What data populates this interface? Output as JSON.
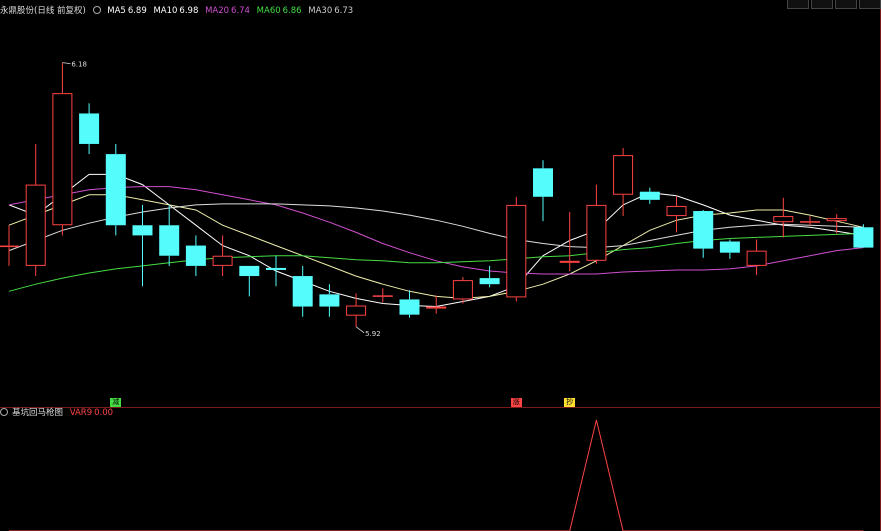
{
  "header": {
    "stock_name": "永鼎股份(日线 前复权)",
    "ma": [
      {
        "label": "MA5",
        "value": "6.89",
        "color": "#ffffff"
      },
      {
        "label": "MA10",
        "value": "6.98",
        "color": "#ffffff"
      },
      {
        "label": "MA20",
        "value": "6.74",
        "color": "#d050d0"
      },
      {
        "label": "MA60",
        "value": "6.86",
        "color": "#44dd44"
      },
      {
        "label": "MA30",
        "value": "6.73",
        "color": "#cccccc"
      }
    ]
  },
  "top_buttons": [
    "",
    "",
    "",
    ""
  ],
  "annotations": {
    "high": "6.18",
    "low": "5.92"
  },
  "indicator": {
    "name": "基坑回马枪图",
    "var_label": "VAR9",
    "var_value": "0.00"
  },
  "signals": [
    {
      "index": 4,
      "text": "减",
      "color": "#44dd44"
    },
    {
      "index": 19,
      "text": "涨",
      "color": "#ff4444"
    },
    {
      "index": 21,
      "text": "抄",
      "color": "#ffdd33"
    }
  ],
  "colors": {
    "up": "#ff4444",
    "down": "#54fcfc",
    "bg": "#000000",
    "border": "#7a1a1a",
    "ma5": "#ffffff",
    "ma10": "#eeeeaa",
    "ma20": "#d050d0",
    "ma30": "#dddddd",
    "ma60": "#44dd44"
  },
  "chart_data": {
    "type": "candlestick",
    "price_range": [
      5.85,
      6.22
    ],
    "candles": [
      {
        "o": 6.0,
        "h": 6.02,
        "l": 5.98,
        "c": 6.0
      },
      {
        "o": 5.98,
        "h": 6.1,
        "l": 5.97,
        "c": 6.06
      },
      {
        "o": 6.02,
        "h": 6.18,
        "l": 6.01,
        "c": 6.15
      },
      {
        "o": 6.13,
        "h": 6.14,
        "l": 6.09,
        "c": 6.1
      },
      {
        "o": 6.09,
        "h": 6.1,
        "l": 6.01,
        "c": 6.02
      },
      {
        "o": 6.02,
        "h": 6.04,
        "l": 5.96,
        "c": 6.01
      },
      {
        "o": 6.02,
        "h": 6.04,
        "l": 5.98,
        "c": 5.99
      },
      {
        "o": 6.0,
        "h": 6.01,
        "l": 5.97,
        "c": 5.98
      },
      {
        "o": 5.98,
        "h": 6.01,
        "l": 5.97,
        "c": 5.99
      },
      {
        "o": 5.98,
        "h": 5.98,
        "l": 5.95,
        "c": 5.97
      },
      {
        "o": 5.978,
        "h": 5.99,
        "l": 5.96,
        "c": 5.976
      },
      {
        "o": 5.97,
        "h": 5.98,
        "l": 5.93,
        "c": 5.94
      },
      {
        "o": 5.952,
        "h": 5.962,
        "l": 5.93,
        "c": 5.94
      },
      {
        "o": 5.931,
        "h": 5.953,
        "l": 5.92,
        "c": 5.941
      },
      {
        "o": 5.95,
        "h": 5.958,
        "l": 5.944,
        "c": 5.951
      },
      {
        "o": 5.947,
        "h": 5.956,
        "l": 5.929,
        "c": 5.932
      },
      {
        "o": 5.938,
        "h": 5.951,
        "l": 5.933,
        "c": 5.94
      },
      {
        "o": 5.947,
        "h": 5.969,
        "l": 5.943,
        "c": 5.966
      },
      {
        "o": 5.968,
        "h": 5.98,
        "l": 5.959,
        "c": 5.962
      },
      {
        "o": 5.949,
        "h": 6.048,
        "l": 5.945,
        "c": 6.04
      },
      {
        "o": 6.076,
        "h": 6.084,
        "l": 6.024,
        "c": 6.048
      },
      {
        "o": 5.983,
        "h": 6.033,
        "l": 5.975,
        "c": 5.985
      },
      {
        "o": 5.985,
        "h": 6.06,
        "l": 5.982,
        "c": 6.04
      },
      {
        "o": 6.05,
        "h": 6.096,
        "l": 6.029,
        "c": 6.089
      },
      {
        "o": 6.053,
        "h": 6.057,
        "l": 6.041,
        "c": 6.045
      },
      {
        "o": 6.029,
        "h": 6.049,
        "l": 6.013,
        "c": 6.039
      },
      {
        "o": 6.034,
        "h": 6.035,
        "l": 5.988,
        "c": 5.997
      },
      {
        "o": 6.004,
        "h": 6.006,
        "l": 5.987,
        "c": 5.993
      },
      {
        "o": 5.98,
        "h": 6.006,
        "l": 5.971,
        "c": 5.995
      },
      {
        "o": 6.023,
        "h": 6.047,
        "l": 6.008,
        "c": 6.029
      },
      {
        "o": 6.023,
        "h": 6.029,
        "l": 6.02,
        "c": 6.024
      },
      {
        "o": 6.024,
        "h": 6.031,
        "l": 6.012,
        "c": 6.027
      },
      {
        "o": 6.018,
        "h": 6.021,
        "l": 5.998,
        "c": 5.998
      }
    ],
    "series": [
      {
        "name": "MA5",
        "color": "#ffffff",
        "values": [
          6.04,
          6.03,
          6.05,
          6.07,
          6.07,
          6.06,
          6.04,
          6.02,
          6.0,
          5.99,
          5.975,
          5.965,
          5.955,
          5.948,
          5.943,
          5.941,
          5.94,
          5.945,
          5.95,
          5.96,
          5.99,
          6.005,
          6.015,
          6.04,
          6.052,
          6.049,
          6.04,
          6.03,
          6.025,
          6.02,
          6.018,
          6.014,
          6.01
        ]
      },
      {
        "name": "MA10",
        "color": "#eeeeaa",
        "values": [
          6.02,
          6.03,
          6.04,
          6.05,
          6.05,
          6.045,
          6.04,
          6.035,
          6.02,
          6.01,
          6.0,
          5.99,
          5.98,
          5.97,
          5.962,
          5.955,
          5.95,
          5.948,
          5.95,
          5.955,
          5.962,
          5.972,
          5.985,
          6.0,
          6.015,
          6.025,
          6.03,
          6.032,
          6.035,
          6.035,
          6.03,
          6.024,
          6.018
        ]
      },
      {
        "name": "MA20",
        "color": "#d050d0",
        "values": [
          6.04,
          6.045,
          6.05,
          6.055,
          6.057,
          6.058,
          6.058,
          6.055,
          6.05,
          6.045,
          6.04,
          6.032,
          6.023,
          6.013,
          6.002,
          5.993,
          5.985,
          5.979,
          5.975,
          5.973,
          5.972,
          5.972,
          5.972,
          5.974,
          5.975,
          5.976,
          5.976,
          5.977,
          5.98,
          5.985,
          5.99,
          5.995,
          5.998
        ]
      },
      {
        "name": "MA30",
        "color": "#dddddd",
        "values": [
          5.995,
          6.005,
          6.015,
          6.022,
          6.028,
          6.033,
          6.037,
          6.04,
          6.041,
          6.041,
          6.041,
          6.04,
          6.039,
          6.037,
          6.034,
          6.03,
          6.025,
          6.019,
          6.012,
          6.006,
          6.002,
          5.999,
          5.998,
          6.0,
          6.005,
          6.01,
          6.015,
          6.018,
          6.02,
          6.021,
          6.02,
          6.019,
          6.018
        ]
      },
      {
        "name": "MA60",
        "color": "#44dd44",
        "values": [
          5.955,
          5.962,
          5.968,
          5.973,
          5.977,
          5.98,
          5.983,
          5.986,
          5.988,
          5.989,
          5.99,
          5.99,
          5.988,
          5.986,
          5.985,
          5.983,
          5.983,
          5.984,
          5.985,
          5.987,
          5.989,
          5.99,
          5.993,
          5.996,
          5.998,
          6.002,
          6.005,
          6.007,
          6.008,
          6.009,
          6.01,
          6.011,
          6.012
        ]
      }
    ],
    "indicator_values": [
      0,
      0,
      0,
      0,
      0,
      0,
      0,
      0,
      0,
      0,
      0,
      0,
      0,
      0,
      0,
      0,
      0,
      0,
      0,
      0,
      0,
      0,
      1,
      0,
      0,
      0,
      0,
      0,
      0,
      0,
      0,
      0,
      0
    ]
  }
}
